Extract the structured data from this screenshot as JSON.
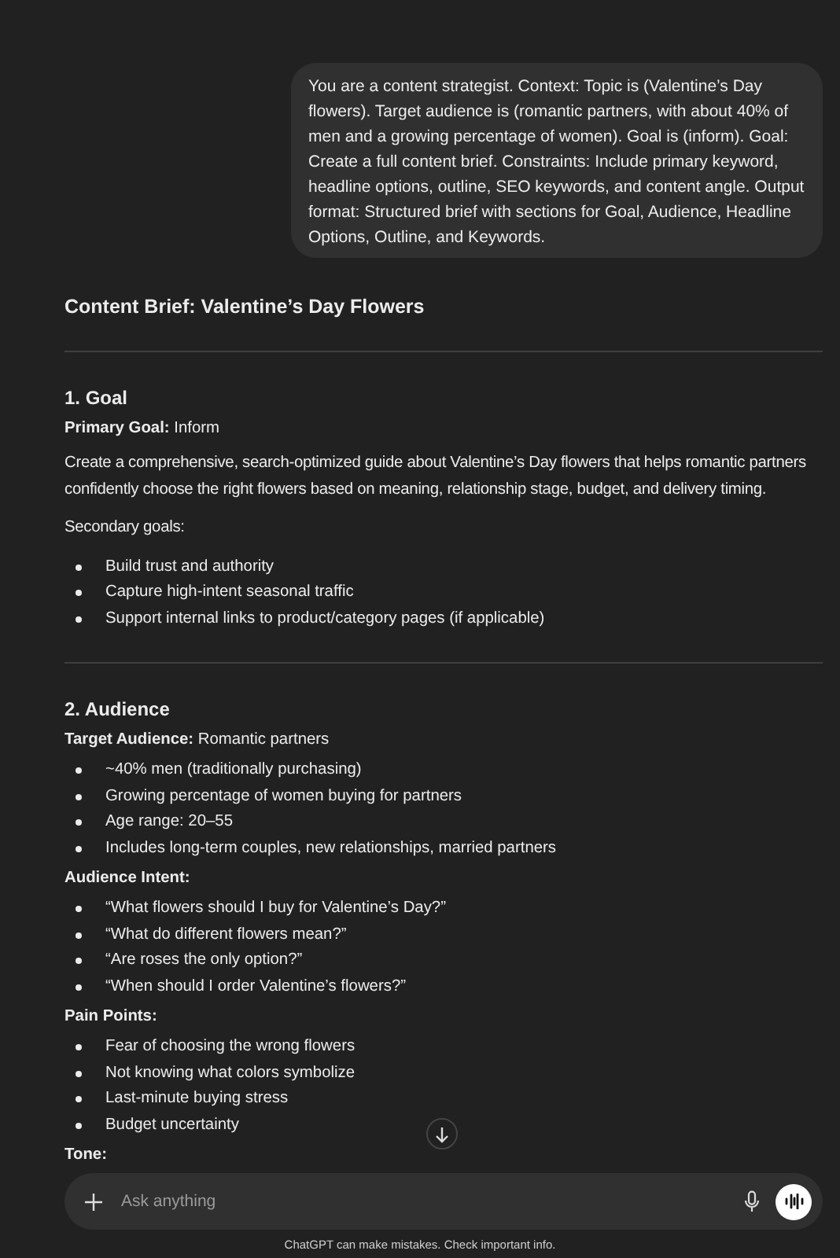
{
  "user_message": "You are a content strategist. Context: Topic is (Valentine’s Day flowers). Target audience is (romantic partners, with about 40% of men and a growing percentage of women). Goal is (inform). Goal: Create a full content brief. Constraints: Include primary keyword, headline options, outline, SEO keywords, and content angle. Output format: Structured brief with sections for Goal, Audience, Headline Options, Outline, and Keywords.",
  "response": [
    {
      "kind": "title",
      "text": "Content Brief: Valentine’s Day Flowers"
    },
    {
      "kind": "rule"
    },
    {
      "kind": "heading",
      "text": "1. Goal"
    },
    {
      "kind": "line",
      "text": "**Primary Goal:** Inform"
    },
    {
      "kind": "paragraph",
      "text": "Create a comprehensive, search-optimized guide about Valentine’s Day flowers that helps romantic partners confidently choose the right flowers based on meaning, relationship stage, budget, and delivery timing."
    },
    {
      "kind": "paragraph",
      "text": "Secondary goals:"
    },
    {
      "kind": "list",
      "items": [
        "Build trust and authority",
        "Capture high-intent seasonal traffic",
        "Support internal links to product/category pages (if applicable)"
      ]
    },
    {
      "kind": "rule"
    },
    {
      "kind": "heading",
      "text": "2. Audience"
    },
    {
      "kind": "line",
      "text": "**Target Audience:** Romantic partners"
    },
    {
      "kind": "list",
      "items": [
        "~40% men (traditionally purchasing)",
        "Growing percentage of women buying for partners",
        "Age range: 20–55",
        "Includes long-term couples, new relationships, married partners"
      ]
    },
    {
      "kind": "label",
      "text": "Audience Intent:"
    },
    {
      "kind": "list",
      "items": [
        "“What flowers should I buy for Valentine’s Day?”",
        "“What do different flowers mean?”",
        "“Are roses the only option?”",
        "“When should I order Valentine’s flowers?”"
      ]
    },
    {
      "kind": "label",
      "text": "Pain Points:"
    },
    {
      "kind": "list",
      "items": [
        "Fear of choosing the wrong flowers",
        "Not knowing what colors symbolize",
        "Last-minute buying stress",
        "Budget uncertainty"
      ]
    },
    {
      "kind": "label",
      "text": "Tone:"
    }
  ],
  "composer": {
    "placeholder": "Ask anything"
  },
  "disclaimer": "ChatGPT can make mistakes. Check important info."
}
